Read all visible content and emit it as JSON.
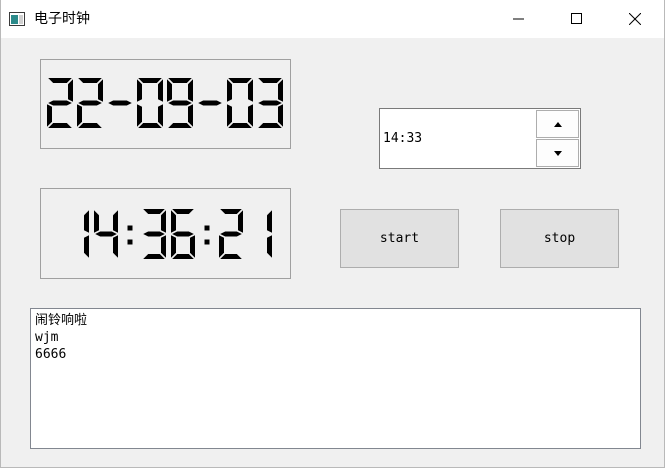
{
  "window": {
    "title": "电子时钟"
  },
  "titlebar_controls": {
    "minimize_icon": "minimize-icon",
    "maximize_icon": "maximize-icon",
    "close_icon": "close-icon"
  },
  "date_display": "22-09-03",
  "time_display": "14:36:21",
  "alarm_time": {
    "value": "14:33",
    "up_icon": "arrow-up-icon",
    "down_icon": "arrow-down-icon"
  },
  "buttons": {
    "start_label": "start",
    "stop_label": "stop"
  },
  "log_lines": [
    "闹铃响啦",
    "wjm",
    "6666"
  ]
}
